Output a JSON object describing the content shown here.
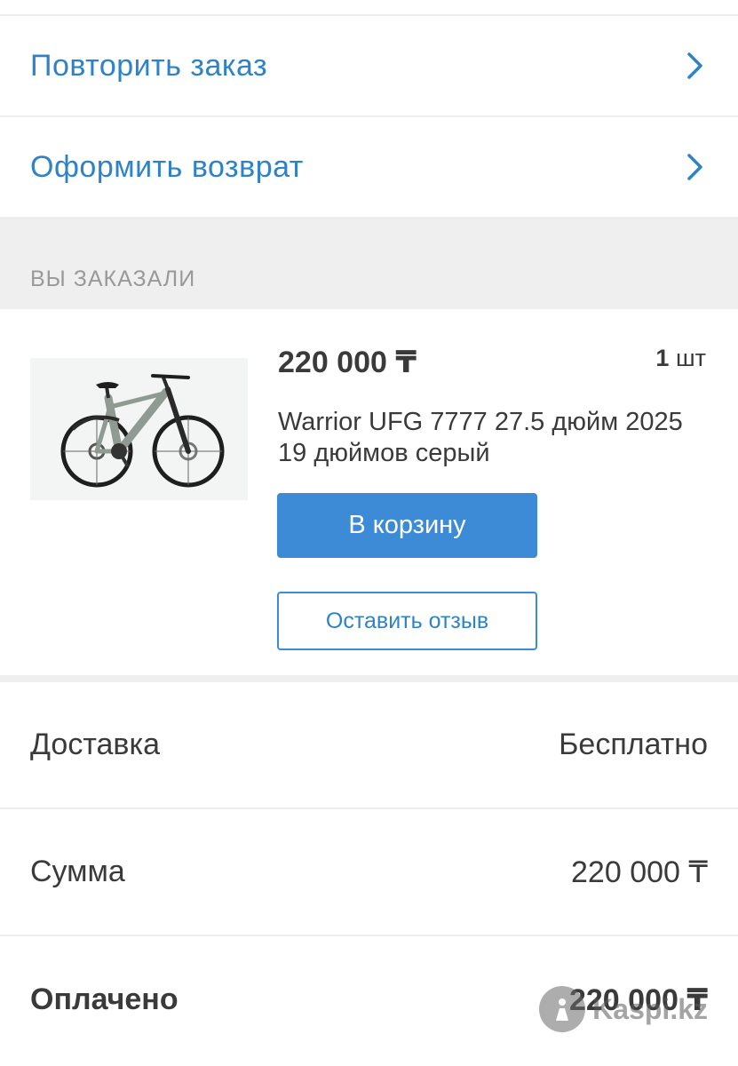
{
  "actions": {
    "repeat_order": "Повторить заказ",
    "return_order": "Оформить возврат"
  },
  "ordered_section": {
    "header": "ВЫ ЗАКАЗАЛИ"
  },
  "product": {
    "price": "220 000 ₸",
    "quantity_value": "1",
    "quantity_unit": "шт",
    "name": "Warrior UFG 7777 27.5 дюйм 2025 19 дюймов серый",
    "image_icon": "bicycle-icon",
    "add_to_cart_label": "В корзину",
    "leave_review_label": "Оставить отзыв"
  },
  "summary": {
    "delivery_label": "Доставка",
    "delivery_value": "Бесплатно",
    "total_label": "Сумма",
    "total_value": "220 000 ₸",
    "paid_label": "Оплачено",
    "paid_value": "220 000 ₸"
  },
  "watermark": "Kaspi.kz",
  "colors": {
    "accent": "#3d8bd6",
    "link": "#2f82c7",
    "section_bg": "#efefef",
    "text": "#3a3a3a",
    "muted": "#999999"
  }
}
